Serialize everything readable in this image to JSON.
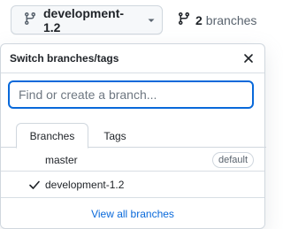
{
  "branch_button": {
    "label": "development-1.2",
    "icon": "git-branch-icon",
    "caret_icon": "caret-down-icon"
  },
  "branch_count": {
    "count": "2",
    "label": "branches",
    "icon": "git-branch-icon"
  },
  "dropdown": {
    "title": "Switch branches/tags",
    "close_icon": "close-icon",
    "filter": {
      "placeholder": "Find or create a branch...",
      "value": ""
    },
    "tabs": [
      {
        "label": "Branches",
        "active": true
      },
      {
        "label": "Tags",
        "active": false
      }
    ],
    "branches": [
      {
        "name": "master",
        "badge": "default",
        "selected": false
      },
      {
        "name": "development-1.2",
        "badge": "",
        "selected": true
      }
    ],
    "footer_link": "View all branches"
  },
  "colors": {
    "accent": "#0969da",
    "border": "#d0d7de",
    "text": "#1f2328",
    "muted": "#59636e",
    "button_bg": "#f6f8fa"
  }
}
